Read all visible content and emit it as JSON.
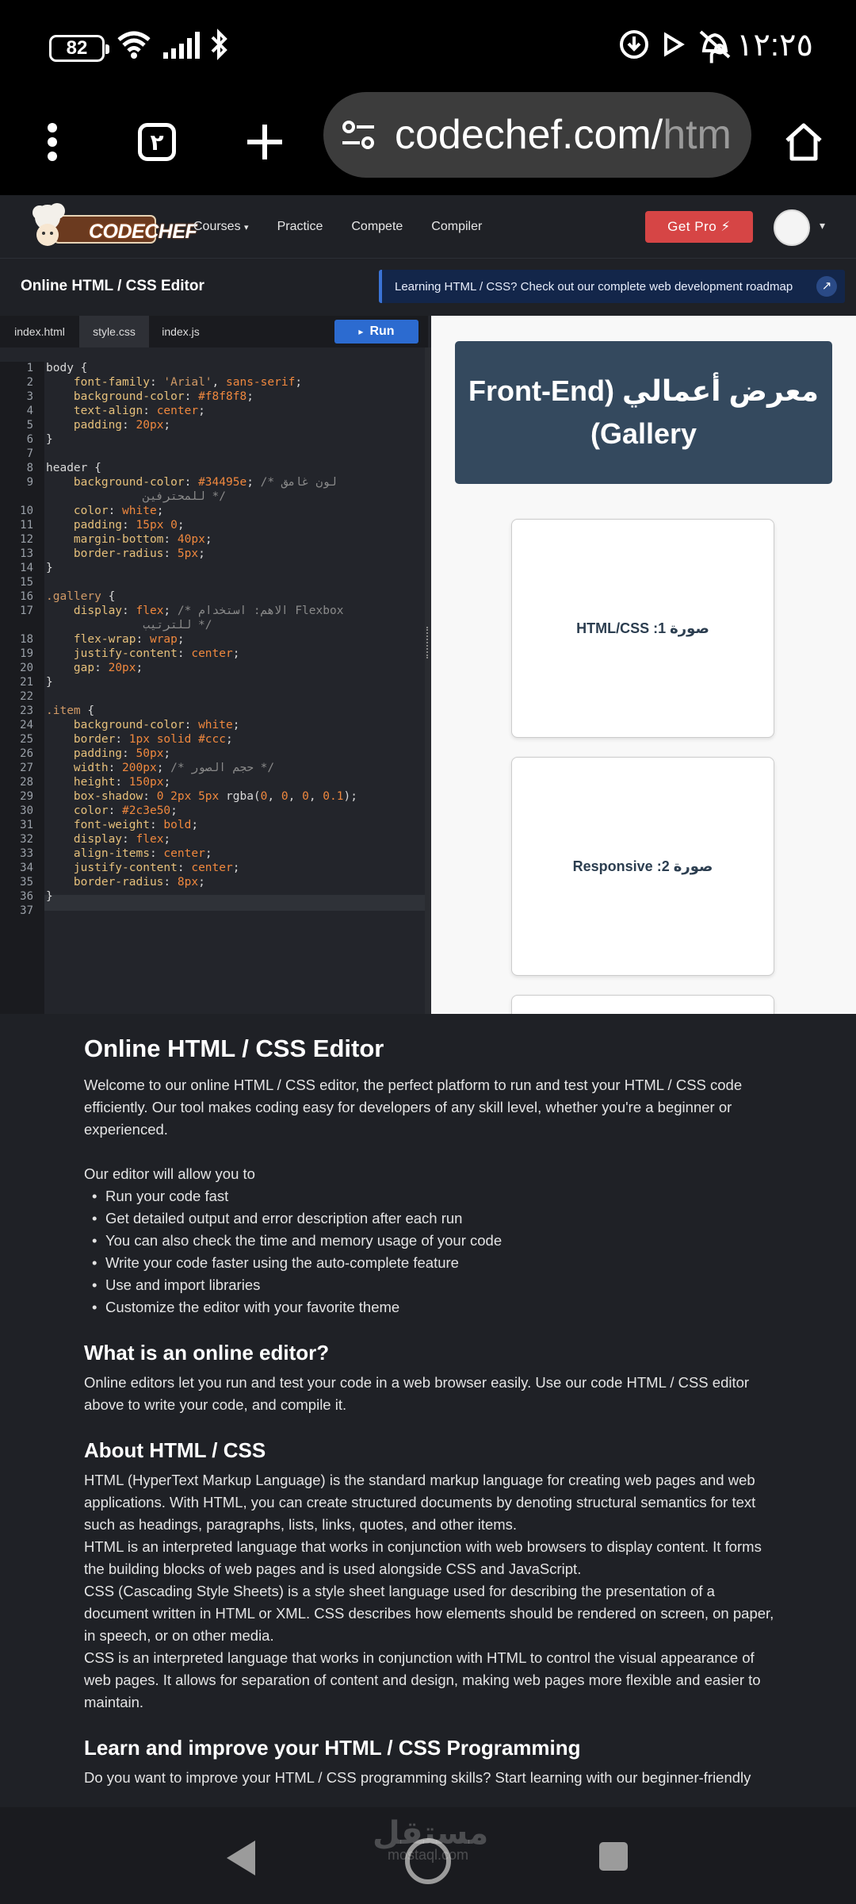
{
  "status_bar": {
    "battery": "82",
    "time": "١٢:٢٥ م"
  },
  "browser": {
    "tab_count": "٢",
    "url_main": "codechef.com/",
    "url_rest": "htm"
  },
  "nav": {
    "logo": "CODECHEF",
    "links": [
      "Courses",
      "Practice",
      "Compete",
      "Compiler"
    ],
    "courses_caret": "▾",
    "get_pro": "Get Pro ⚡",
    "avatar_caret": "▾"
  },
  "editor_header": {
    "title": "Online HTML / CSS Editor",
    "banner": "Learning HTML / CSS? Check out our complete web development roadmap",
    "banner_arrow": "↗"
  },
  "editor": {
    "tabs": [
      "index.html",
      "style.css",
      "index.js"
    ],
    "active_tab": "style.css",
    "run_label": "Run",
    "run_icon": "▸"
  },
  "preview": {
    "header_line1": "معرض أعمالي (Front-End",
    "header_line2": "Gallery)",
    "items": [
      "صورة 1: HTML/CSS",
      "صورة 2: Responsive"
    ]
  },
  "article": {
    "title": "Online HTML / CSS Editor",
    "intro": "Welcome to our online HTML / CSS editor, the perfect platform to run and test your HTML / CSS code efficiently. Our tool makes coding easy for developers of any skill level, whether you're a beginner or experienced.",
    "list_intro": "Our editor will allow you to",
    "features": [
      "Run your code fast",
      "Get detailed output and error description after each run",
      "You can also check the time and memory usage of your code",
      "Write your code faster using the auto-complete feature",
      "Use and import libraries",
      "Customize the editor with your favorite theme"
    ],
    "h_online_editor": "What is an online editor?",
    "p_online_editor": "Online editors let you run and test your code in a web browser easily. Use our code HTML / CSS editor above to write your code, and compile it.",
    "h_about": "About HTML / CSS",
    "about_paragraphs": [
      "HTML (HyperText Markup Language) is the standard markup language for creating web pages and web applications. With HTML, you can create structured documents by denoting structural semantics for text such as headings, paragraphs, lists, links, quotes, and other items.",
      "HTML is an interpreted language that works in conjunction with web browsers to display content. It forms the building blocks of web pages and is used alongside CSS and JavaScript.",
      "CSS (Cascading Style Sheets) is a style sheet language used for describing the presentation of a document written in HTML or XML. CSS describes how elements should be rendered on screen, on paper, in speech, or on other media.",
      "CSS is an interpreted language that works in conjunction with HTML to control the visual appearance of web pages. It allows for separation of content and design, making web pages more flexible and easier to maintain."
    ],
    "h_learn": "Learn and improve your HTML / CSS Programming",
    "p_learn": "Do you want to improve your HTML / CSS programming skills? Start learning with our beginner-friendly"
  },
  "watermark": {
    "arabic": "مستقل",
    "latin": "mostaql.com"
  }
}
